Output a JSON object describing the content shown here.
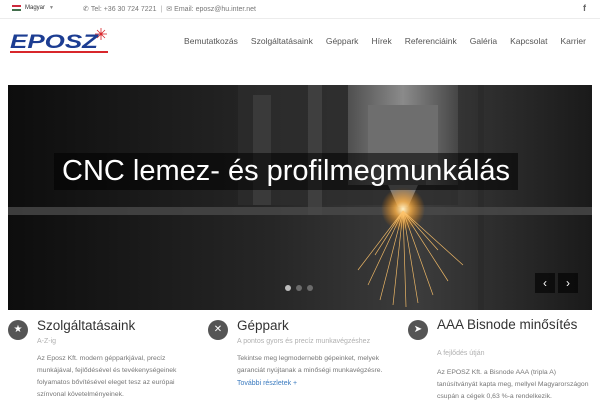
{
  "topbar": {
    "language": "Magyar",
    "phone": "Tel: +36 30 724 7221",
    "separator": "|",
    "email": "Email: eposz@hu.inter.net",
    "social_icon": "facebook-icon",
    "social_glyph": "f"
  },
  "header": {
    "logo_text": "EPOSZ",
    "nav": [
      "Bemutatkozás",
      "Szolgáltatásaink",
      "Géppark",
      "Hírek",
      "Referenciáink",
      "Galéria",
      "Kapcsolat",
      "Karrier"
    ]
  },
  "hero": {
    "title": "CNC lemez- és profilmegmunkálás",
    "slide_count": 3,
    "active_slide": 1,
    "prev_glyph": "‹",
    "next_glyph": "›"
  },
  "features": [
    {
      "icon": "star-icon",
      "icon_glyph": "★",
      "title": "Szolgáltatásaink",
      "subtitle": "A-Z-ig",
      "text": "Az Eposz Kft. modern gépparkjával, precíz munkájával, fejlődésével és tevékenységeinek folyamatos bővítésével eleget tesz az európai színvonal követelményeinek."
    },
    {
      "icon": "tools-icon",
      "icon_glyph": "✕",
      "title": "Géppark",
      "subtitle": "A pontos gyors és precíz munkavégzéshez",
      "text": "Tekintse meg legmodernebb gépeinket, melyek garanciát nyújtanak a minőségi munkavégzésre.",
      "link": "További részletek +"
    },
    {
      "icon": "rocket-icon",
      "icon_glyph": "➤",
      "title": "AAA Bisnode minősítés",
      "subtitle": "A fejlődés útján",
      "text": "Az EPOSZ Kft. a Bisnode AAA (tripla A) tanúsítványát kapta meg, mellyel Magyarországon csupán a cégek 0,63 %-a rendelkezik."
    }
  ],
  "colors": {
    "logo_blue": "#1c3d92",
    "logo_red": "#d8262b",
    "link_blue": "#3a7abf",
    "icon_grey": "#555555"
  }
}
